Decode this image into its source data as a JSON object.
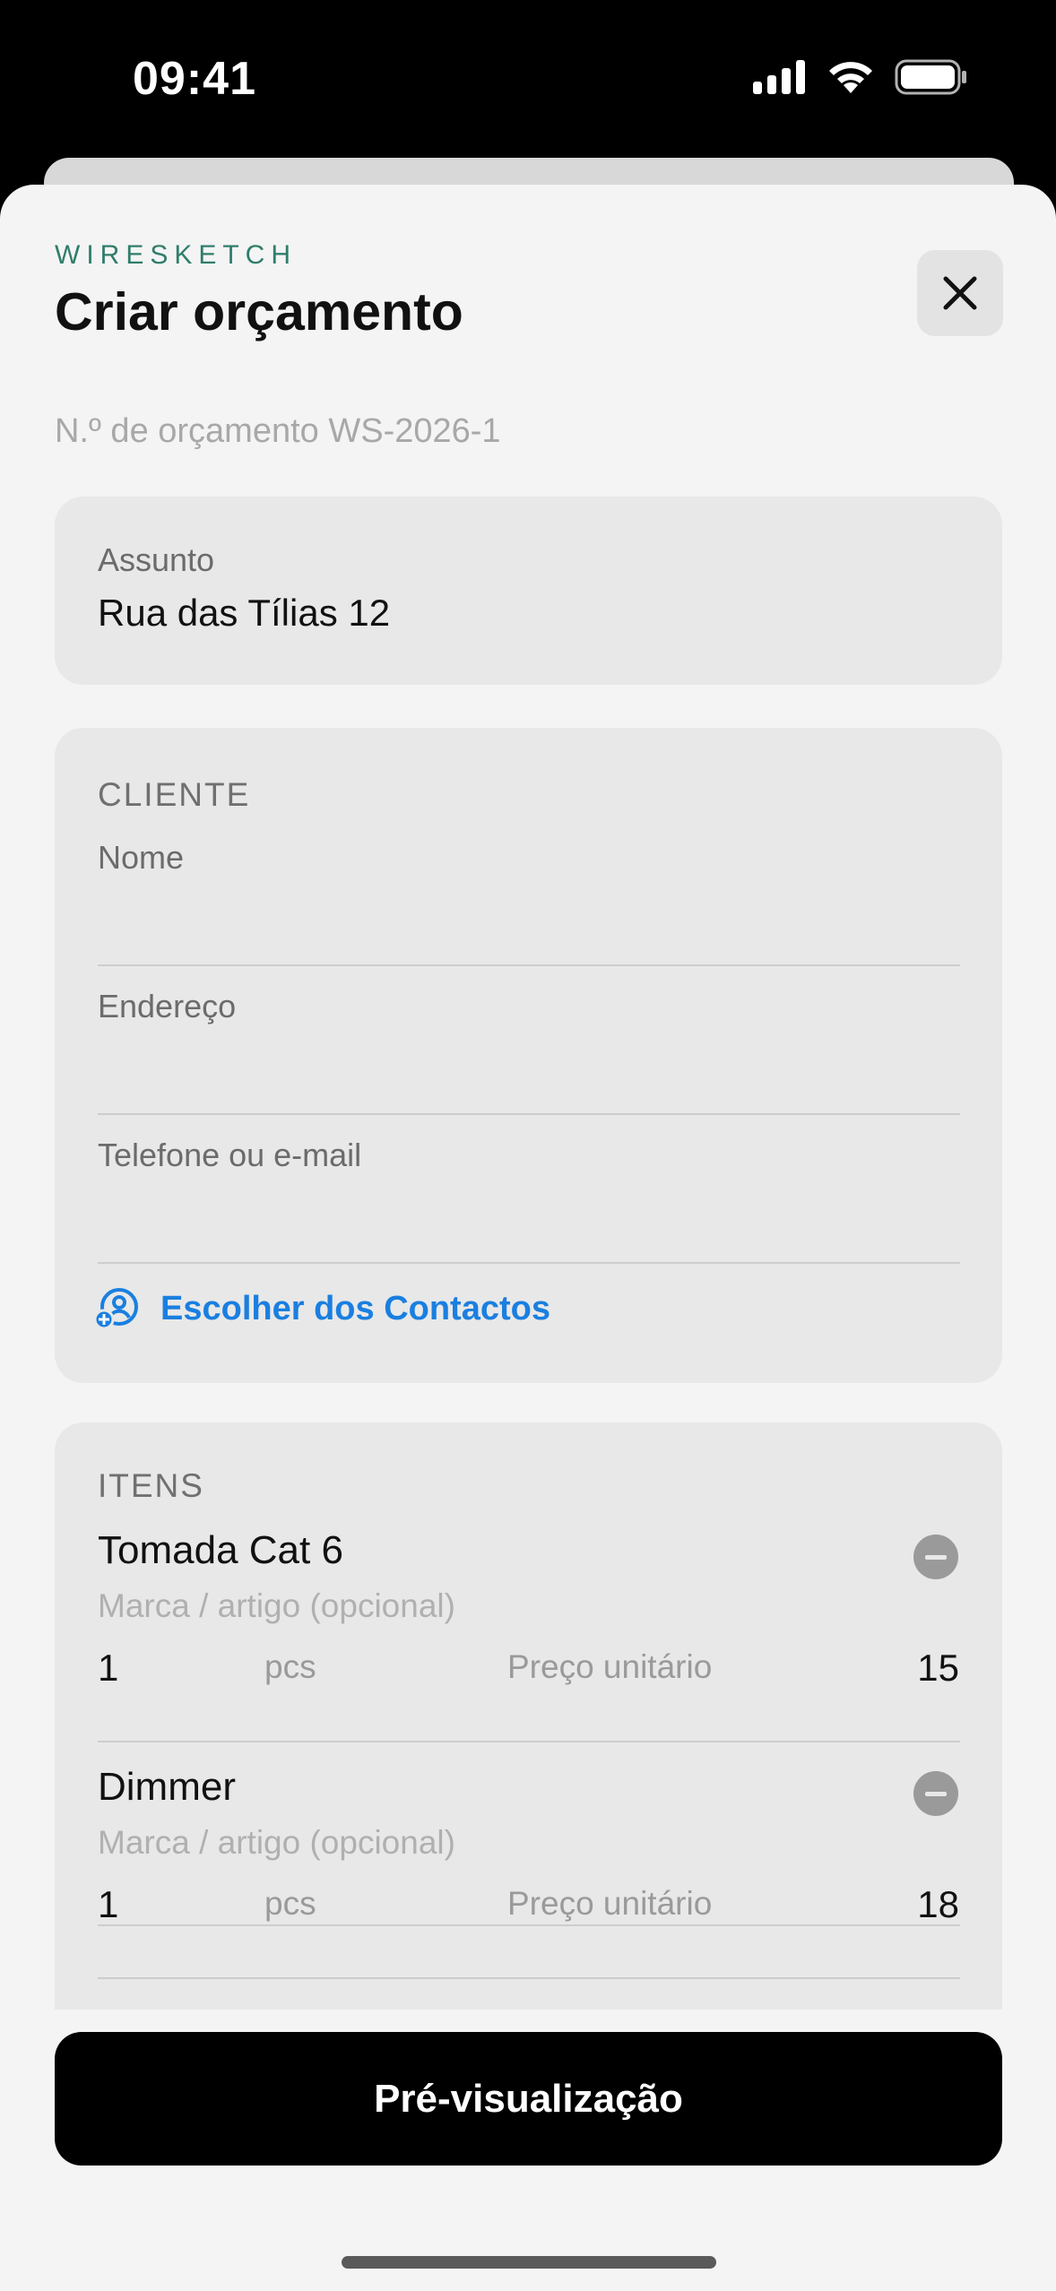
{
  "status_bar": {
    "time": "09:41",
    "icons": [
      "cellular-signal-icon",
      "wifi-icon",
      "battery-icon"
    ]
  },
  "sheet": {
    "brand": "WIRESKETCH",
    "title": "Criar orçamento",
    "close_icon": "close-icon",
    "quote_number": "N.º de orçamento WS-2026-1"
  },
  "subject": {
    "label": "Assunto",
    "value": "Rua das Tílias 12"
  },
  "client": {
    "section_title": "CLIENTE",
    "fields": [
      {
        "label": "Nome",
        "value": ""
      },
      {
        "label": "Endereço",
        "value": ""
      },
      {
        "label": "Telefone ou e-mail",
        "value": ""
      }
    ],
    "contacts_button": "Escolher dos Contactos",
    "contacts_icon": "person-add-icon"
  },
  "items": {
    "section_title": "ITENS",
    "rows": [
      {
        "name": "Tomada Cat 6",
        "brand_placeholder": "Marca / artigo (opcional)",
        "qty": "1",
        "unit": "pcs",
        "price_label": "Preço unitário",
        "price": "15"
      },
      {
        "name": "Dimmer",
        "brand_placeholder": "Marca / artigo (opcional)",
        "qty": "1",
        "unit": "pcs",
        "price_label": "Preço unitário",
        "price": "18"
      }
    ]
  },
  "footer": {
    "preview_button": "Pré-visualização"
  },
  "colors": {
    "brand": "#2f7d6b",
    "link": "#1a7fe0",
    "primary_button": "#000000",
    "card": "#e8e8e8",
    "sheet": "#f4f4f4"
  }
}
